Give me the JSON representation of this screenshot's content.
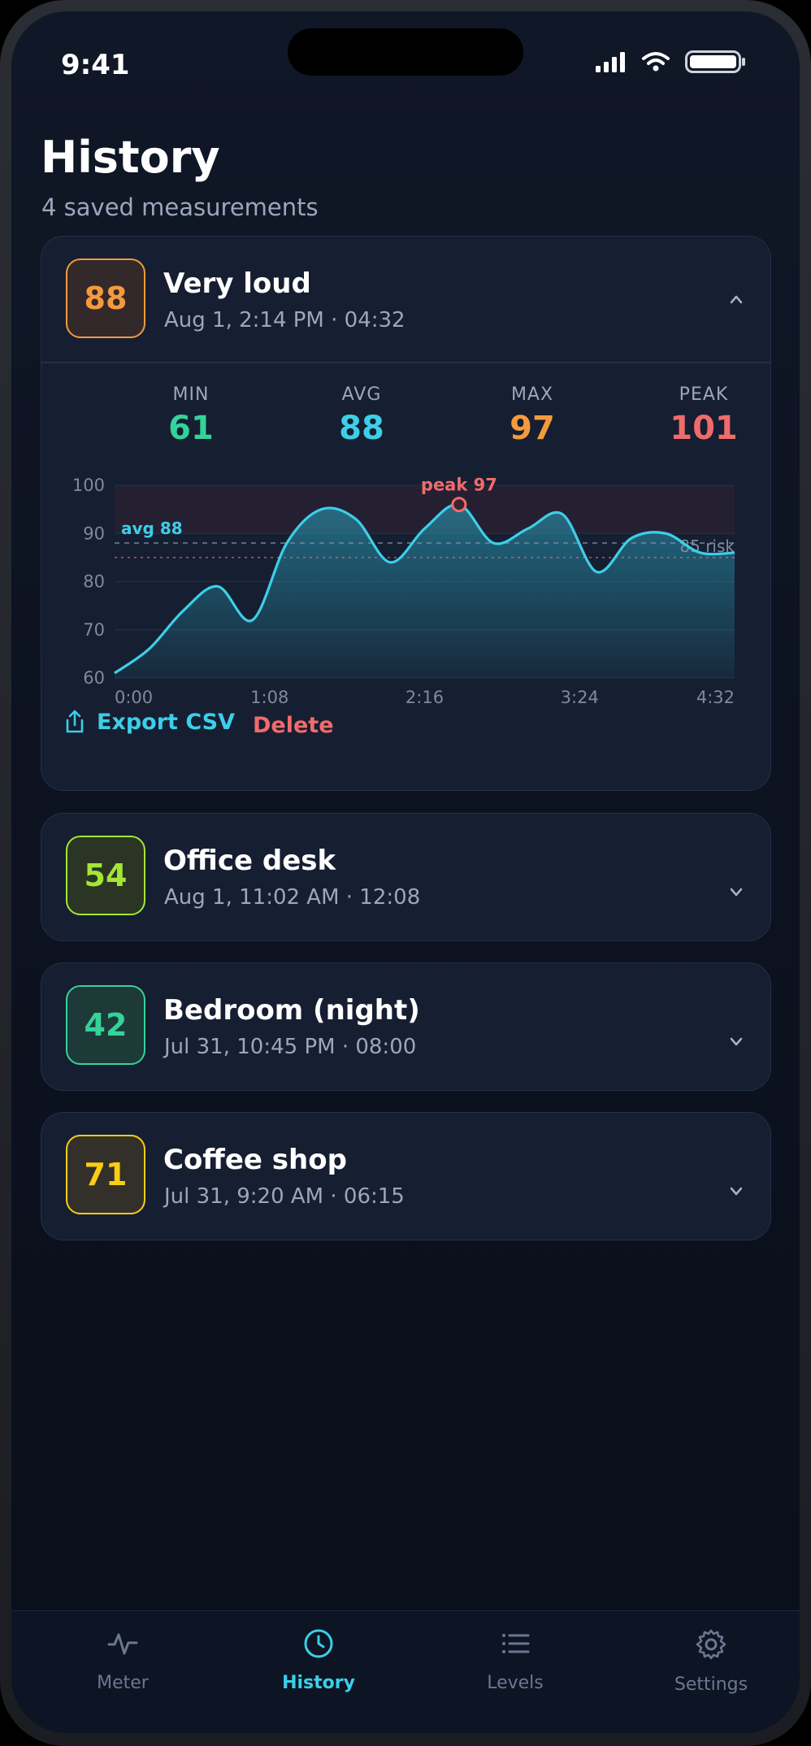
{
  "status": {
    "time": "9:41"
  },
  "header": {
    "title": "History",
    "subtitle": "4 saved measurements"
  },
  "sessions": [
    {
      "score": "88",
      "title": "Very loud",
      "meta": "Aug 1, 2:14 PM · 04:32",
      "color": "#f59a3c",
      "bg": "#33292a",
      "expanded": true
    },
    {
      "score": "54",
      "title": "Office desk",
      "meta": "Aug 1, 11:02 AM · 12:08",
      "color": "#a3e635",
      "bg": "#2a3524",
      "expanded": false
    },
    {
      "score": "42",
      "title": "Bedroom (night)",
      "meta": "Jul 31, 10:45 PM · 08:00",
      "color": "#34d399",
      "bg": "#1d3a39",
      "expanded": false
    },
    {
      "score": "71",
      "title": "Coffee shop",
      "meta": "Jul 31, 9:20 AM · 06:15",
      "color": "#facc15",
      "bg": "#33302a",
      "expanded": false
    }
  ],
  "stats": {
    "min_label": "MIN",
    "min": "61",
    "avg_label": "AVG",
    "avg": "88",
    "max_label": "MAX",
    "max": "97",
    "peak_label": "PEAK",
    "peak": "101"
  },
  "chart_data": {
    "type": "area",
    "x": [
      "0:00",
      "0:15",
      "0:30",
      "0:45",
      "1:00",
      "1:15",
      "1:30",
      "1:45",
      "2:00",
      "2:15",
      "2:30",
      "2:45",
      "3:00",
      "3:15",
      "3:30",
      "3:45",
      "4:00",
      "4:15",
      "4:32"
    ],
    "y": [
      61,
      66,
      74,
      79,
      72,
      88,
      95,
      93,
      84,
      91,
      96,
      88,
      91,
      94,
      82,
      89,
      90,
      86,
      86
    ],
    "xticks": [
      "0:00",
      "1:08",
      "2:16",
      "3:24",
      "4:32"
    ],
    "yticks": [
      "100",
      "90",
      "80",
      "70",
      "60"
    ],
    "ylim": [
      60,
      100
    ],
    "avg_label": "avg 88",
    "avg": 88,
    "risk_label": "85 risk",
    "risk": 85,
    "peak_label": "peak 97",
    "line_color": "#3ccfe8",
    "peak_color": "#f06b6b"
  },
  "actions": {
    "export": "Export CSV",
    "delete": "Delete"
  },
  "tabs": [
    {
      "label": "Meter",
      "active": false
    },
    {
      "label": "History",
      "active": true
    },
    {
      "label": "Levels",
      "active": false
    },
    {
      "label": "Settings",
      "active": false
    }
  ],
  "colors": {
    "accent": "#3ccfe8",
    "danger": "#f06b6b",
    "inactive": "#6b7890"
  }
}
